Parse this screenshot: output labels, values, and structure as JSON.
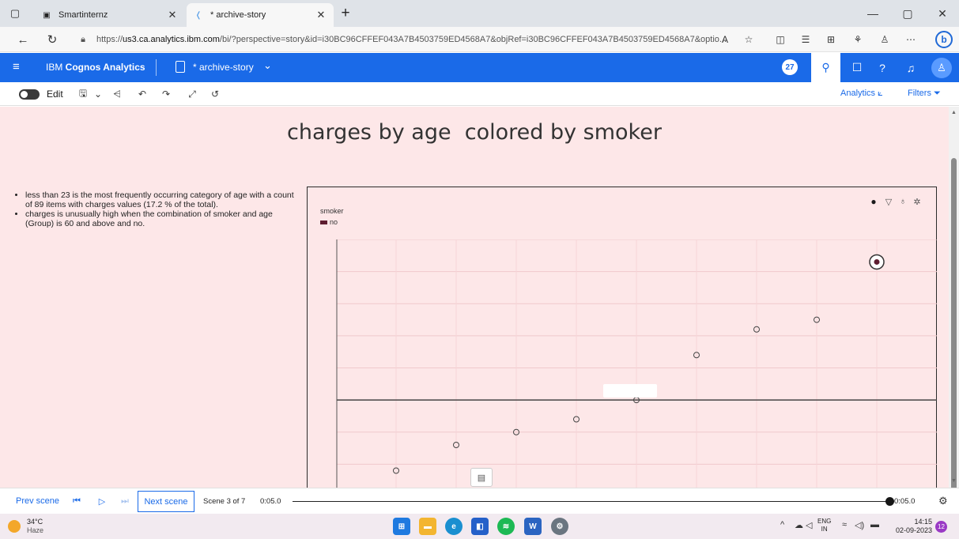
{
  "browser": {
    "tabs": [
      {
        "label": "Smartinternz",
        "active": false
      },
      {
        "label": "* archive-story",
        "active": true
      }
    ],
    "url_prefix": "https://",
    "url_host": "us3.ca.analytics.ibm.com",
    "url_path": "/bi/?perspective=story&id=i30BC96CFFEF043A7B4503759ED4568A7&objRef=i30BC96CFFEF043A7B4503759ED4568A7&optio...",
    "bing_label": "b"
  },
  "app": {
    "brand_prefix": "IBM ",
    "brand_name": "Cognos Analytics",
    "doc_title": "* archive-story",
    "notification_count": "27"
  },
  "toolbar": {
    "edit_label": "Edit",
    "analytics_label": "Analytics",
    "filters_label": "Filters"
  },
  "scene": {
    "title": "charges by age  colored by smoker",
    "insights": [
      "less than 23 is the most frequently occurring category of age  with a count of 89 items with charges values (17.2 % of the total).",
      "charges is unusually high when the combination of smoker and age (Group) is 60 and above and no."
    ],
    "legend_title": "smoker",
    "legend_items": [
      {
        "label": "no",
        "color": "#5e1d30"
      }
    ]
  },
  "chart_data": {
    "type": "scatter",
    "title": "charges by age  colored by smoker",
    "xlabel": "",
    "ylabel": "",
    "legend": "top-left",
    "series": [
      {
        "name": "no",
        "x": [
          1,
          2,
          3,
          4,
          5,
          6,
          7,
          8,
          9
        ],
        "y": [
          4.8,
          5.6,
          6.0,
          6.4,
          7.0,
          8.4,
          9.2,
          9.5,
          11.3
        ],
        "highlighted_index": 8
      }
    ],
    "xlim": [
      0,
      10
    ],
    "ylim": [
      4,
      12
    ],
    "reference_line_y": 7,
    "grid": true
  },
  "player": {
    "prev_label": "Prev scene",
    "next_label": "Next scene",
    "scene_count": "Scene 3 of 7",
    "time_start": "0:05.0",
    "time_end": "0:05.0",
    "progress": 1.0
  },
  "taskbar": {
    "temperature": "34°C",
    "condition": "Haze",
    "lang_line1": "ENG",
    "lang_line2": "IN",
    "time": "14:15",
    "date": "02-09-2023",
    "notification_count": "12",
    "apps": [
      {
        "name": "windows-start",
        "color": "#1f7ae0"
      },
      {
        "name": "file-explorer",
        "color": "#f3b530"
      },
      {
        "name": "edge",
        "color": "#1a8fd0"
      },
      {
        "name": "store",
        "color": "#2560c9"
      },
      {
        "name": "spotify",
        "color": "#1db954"
      },
      {
        "name": "word",
        "color": "#2b64c1"
      },
      {
        "name": "settings",
        "color": "#6a7580"
      }
    ]
  }
}
